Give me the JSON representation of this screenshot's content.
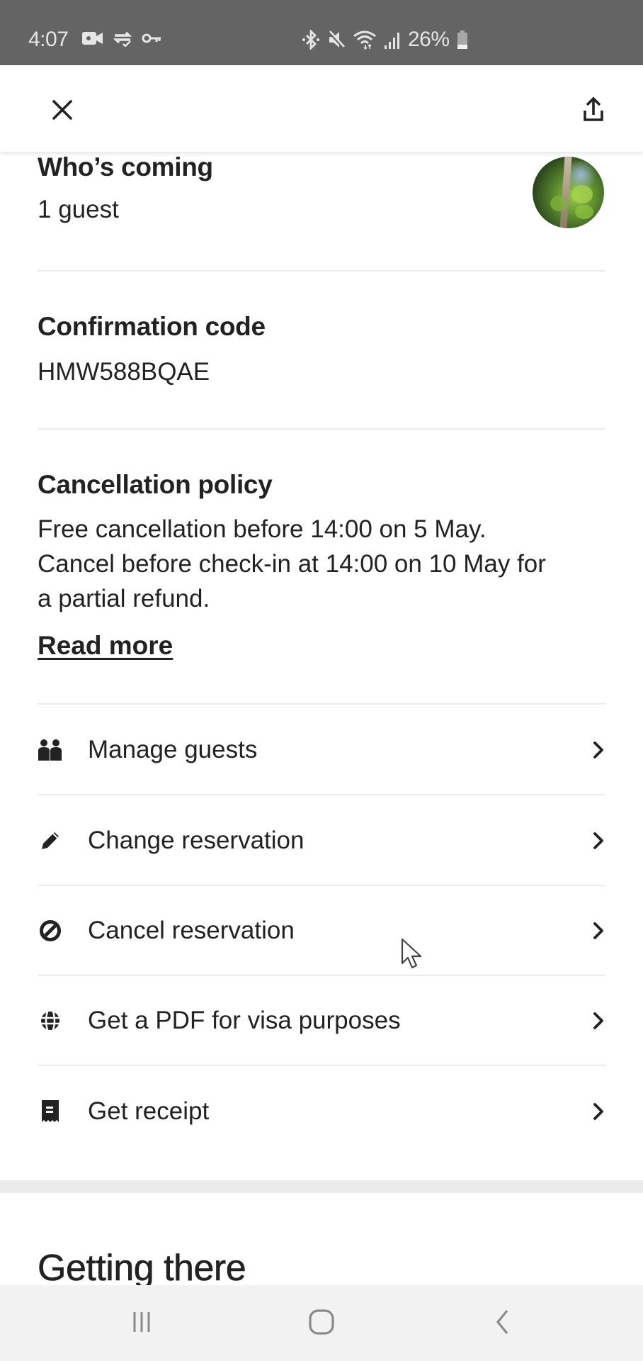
{
  "status_bar": {
    "time": "4:07",
    "left_icons": [
      "video-camera-icon",
      "sync-cloud-icon",
      "vpn-key-icon"
    ],
    "right_icons": [
      "bluetooth-icon",
      "mute-icon",
      "wifi-icon",
      "signal-icon"
    ],
    "battery_percent": "26%",
    "battery_level": 0.26
  },
  "header": {
    "close_icon": "close-icon",
    "share_icon": "share-icon"
  },
  "whos_coming": {
    "title": "Who’s coming",
    "value": "1 guest"
  },
  "confirmation": {
    "title": "Confirmation code",
    "value": "HMW588BQAE"
  },
  "cancellation": {
    "title": "Cancellation policy",
    "lines": [
      "Free cancellation before 14:00 on 5 May.",
      "Cancel before check-in at 14:00 on 10 May for",
      "a partial refund."
    ],
    "read_more": "Read more"
  },
  "actions": [
    {
      "label": "Manage guests",
      "icon": "guests-icon"
    },
    {
      "label": "Change reservation",
      "icon": "pencil-icon"
    },
    {
      "label": "Cancel reservation",
      "icon": "cancel-icon"
    },
    {
      "label": "Get a PDF for visa purposes",
      "icon": "globe-icon"
    },
    {
      "label": "Get receipt",
      "icon": "receipt-icon"
    }
  ],
  "getting_there": {
    "title": "Getting there"
  },
  "nav_bar": {
    "buttons": [
      "recent-apps",
      "home",
      "back"
    ]
  },
  "colors": {
    "text": "#222222",
    "divider": "#ebebeb",
    "status_bar": "#646464",
    "nav_bar": "#f2f2f2"
  }
}
